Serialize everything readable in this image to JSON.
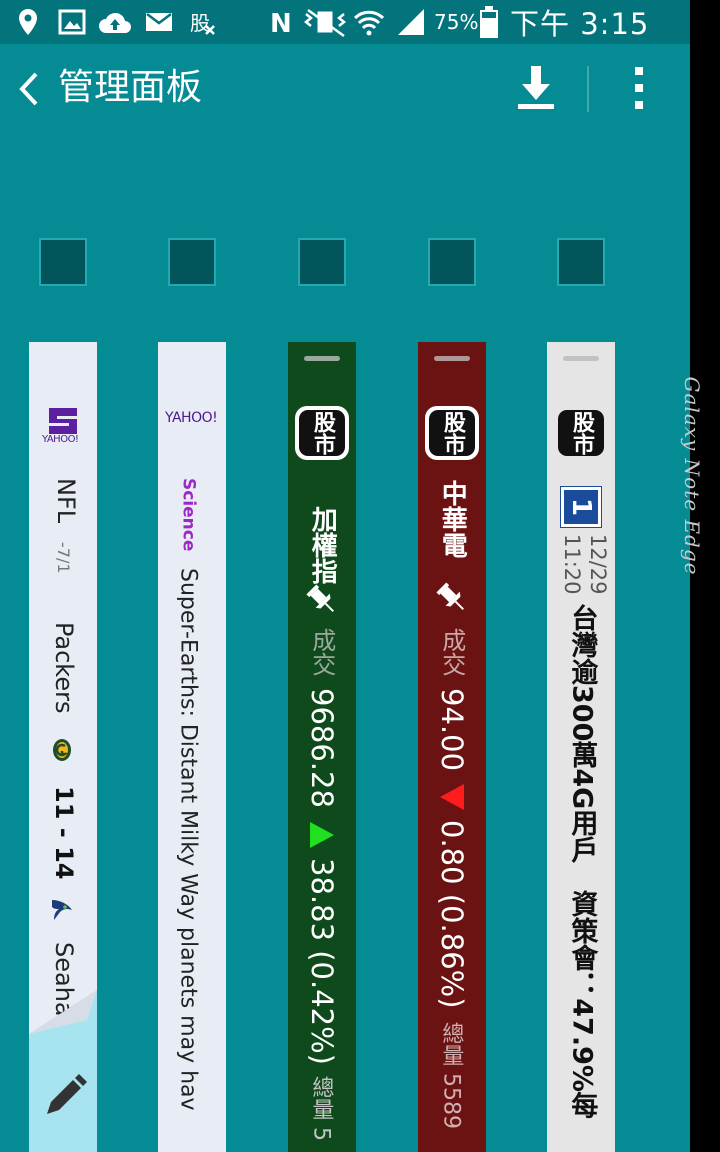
{
  "status_bar": {
    "battery_percent": "75%",
    "time": "下午 3:15",
    "icons": [
      "location-icon",
      "gallery-icon",
      "cloud-upload-icon",
      "mail-icon",
      "stock-notify-icon",
      "nfc-icon",
      "vibrate-icon",
      "wifi-icon",
      "signal-icon",
      "battery-icon"
    ]
  },
  "app_bar": {
    "title": "管理面板",
    "back_icon": "chevron-left-icon",
    "download_icon": "download-icon",
    "more_icon": "more-vert-icon"
  },
  "device": {
    "edge_label": "Galaxy Note Edge"
  },
  "panels": [
    {
      "id": "yahoo-sports",
      "logo_text": "YAHOO!",
      "league": "NFL",
      "date": "-7/1",
      "team1": "Packers",
      "score": "11 - 14",
      "team2": "Seahaw...",
      "edit_icon": "pencil-icon"
    },
    {
      "id": "yahoo-news",
      "logo_text": "YAHOO!",
      "category": "Science",
      "headline": "Super-Earths: Distant Milky Way planets may hav"
    },
    {
      "id": "stock-index",
      "logo_text": "股市",
      "name": "加權指",
      "label_trade": "成交",
      "price": "9686.28",
      "direction": "down",
      "change": "38.83 (0.42%)",
      "volume_label": "總量 5"
    },
    {
      "id": "stock-cht",
      "logo_text": "股市",
      "name": "中華電",
      "label_trade": "成交",
      "price": "94.00",
      "direction": "up",
      "change": "0.80 (0.86%)",
      "volume_label": "總量 5589"
    },
    {
      "id": "stock-news",
      "logo_text": "股市",
      "badge": "1",
      "date": "12/29",
      "time": "11:20",
      "headline": "台灣逾300萬4G用戶　資策會：47.9%每"
    }
  ],
  "colors": {
    "background": "#058b93",
    "status_bar": "#03747c",
    "checkbox": "#02555b",
    "stock_green_panel": "#0f4a1d",
    "stock_red_panel": "#6b1212",
    "up_arrow": "#ff1c1c",
    "down_arrow": "#20e020",
    "yahoo_purple": "#4b1a8e"
  }
}
